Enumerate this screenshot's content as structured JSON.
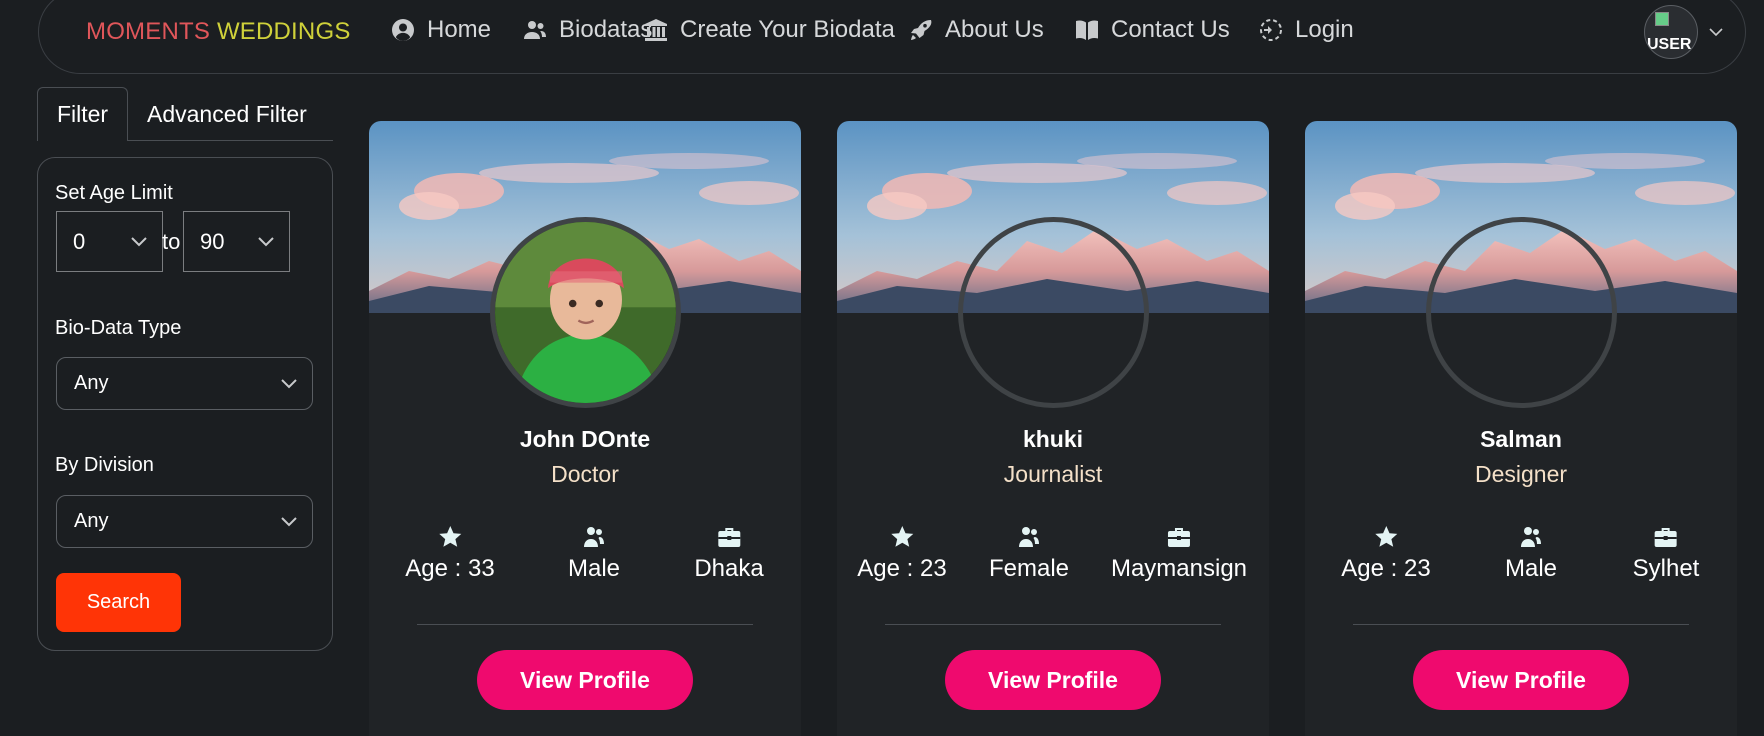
{
  "nav": {
    "brand_part1": "MOMENTS",
    "brand_part2": "WEDDINGS",
    "items": [
      {
        "label": "Home",
        "icon": "user-circle-icon"
      },
      {
        "label": "Biodatas",
        "icon": "users-icon"
      },
      {
        "label": "Create Your Biodata",
        "icon": "bank-icon"
      },
      {
        "label": "About Us",
        "icon": "rocket-icon"
      },
      {
        "label": "Contact Us",
        "icon": "book-icon"
      },
      {
        "label": "Login",
        "icon": "login-icon"
      }
    ],
    "avatar_alt": "USER"
  },
  "filter": {
    "tab_filter": "Filter",
    "tab_advanced": "Advanced Filter",
    "age_label": "Set Age Limit",
    "age_min": "0",
    "age_to": "to",
    "age_max": "90",
    "biodata_type_label": "Bio-Data Type",
    "biodata_type_value": "Any",
    "division_label": "By Division",
    "division_value": "Any",
    "search_label": "Search"
  },
  "cards": [
    {
      "name": "John DOnte",
      "job": "Doctor",
      "age": "Age : 33",
      "gender": "Male",
      "location": "Dhaka",
      "button": "View Profile",
      "has_photo": true
    },
    {
      "name": "khuki",
      "job": "Journalist",
      "age": "Age : 23",
      "gender": "Female",
      "location": "Maymansign",
      "button": "View Profile",
      "has_photo": false
    },
    {
      "name": "Salman",
      "job": "Designer",
      "age": "Age : 23",
      "gender": "Male",
      "location": "Sylhet",
      "button": "View Profile",
      "has_photo": false
    }
  ],
  "colors": {
    "background": "#1b1e21",
    "brand_red": "#e0565a",
    "brand_yellow": "#cfd13a",
    "search_button": "#ff3406",
    "view_button": "#ef0a6e",
    "job_text": "#f4e0c8"
  }
}
